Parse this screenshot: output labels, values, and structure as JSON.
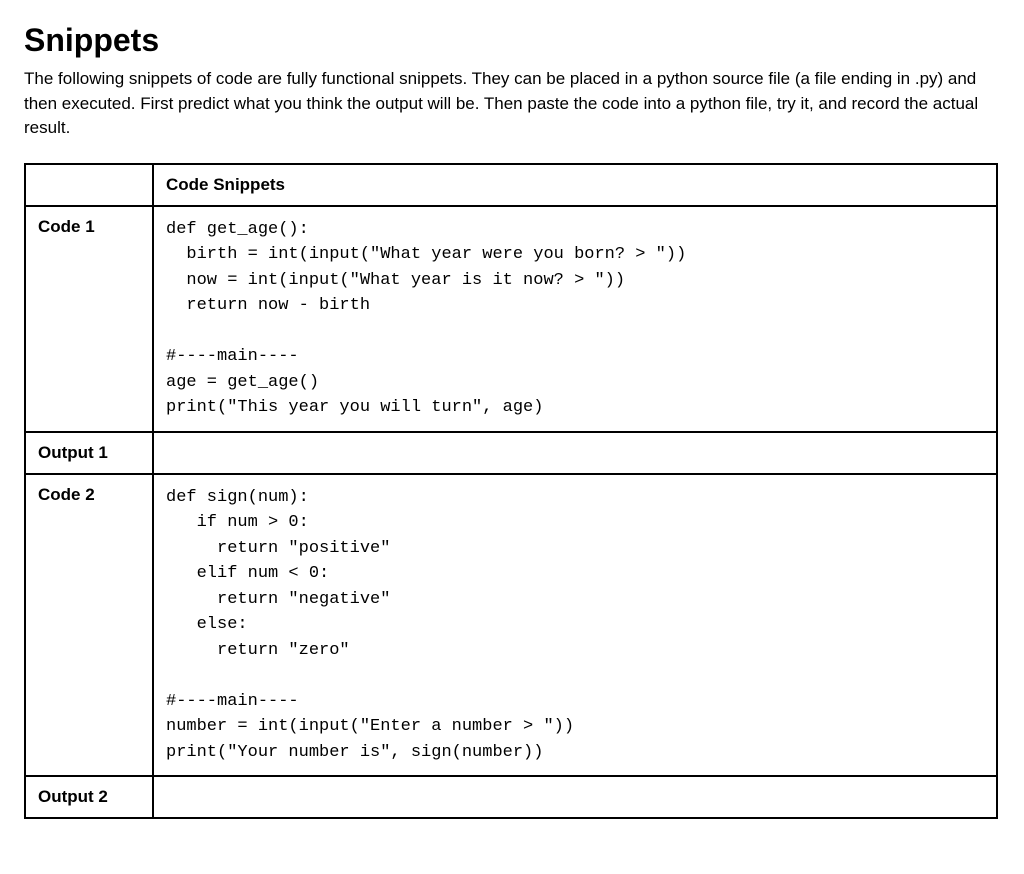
{
  "heading": "Snippets",
  "intro": "The following snippets of code are fully functional snippets. They can be placed in a python source file (a file ending in .py) and then executed. First predict what you think the output will be. Then paste the code into a python file, try it, and record the actual result.",
  "table": {
    "header_label": "",
    "header_content": "Code Snippets",
    "rows": [
      {
        "label": "Code 1",
        "code": "def get_age():\n  birth = int(input(\"What year were you born? > \"))\n  now = int(input(\"What year is it now? > \"))\n  return now - birth\n\n#----main----\nage = get_age()\nprint(\"This year you will turn\", age)"
      },
      {
        "label": "Output 1",
        "code": ""
      },
      {
        "label": "Code 2",
        "code": "def sign(num):\n   if num > 0:\n     return \"positive\"\n   elif num < 0:\n     return \"negative\"\n   else:\n     return \"zero\"\n\n#----main----\nnumber = int(input(\"Enter a number > \"))\nprint(\"Your number is\", sign(number))"
      },
      {
        "label": "Output 2",
        "code": ""
      }
    ]
  }
}
